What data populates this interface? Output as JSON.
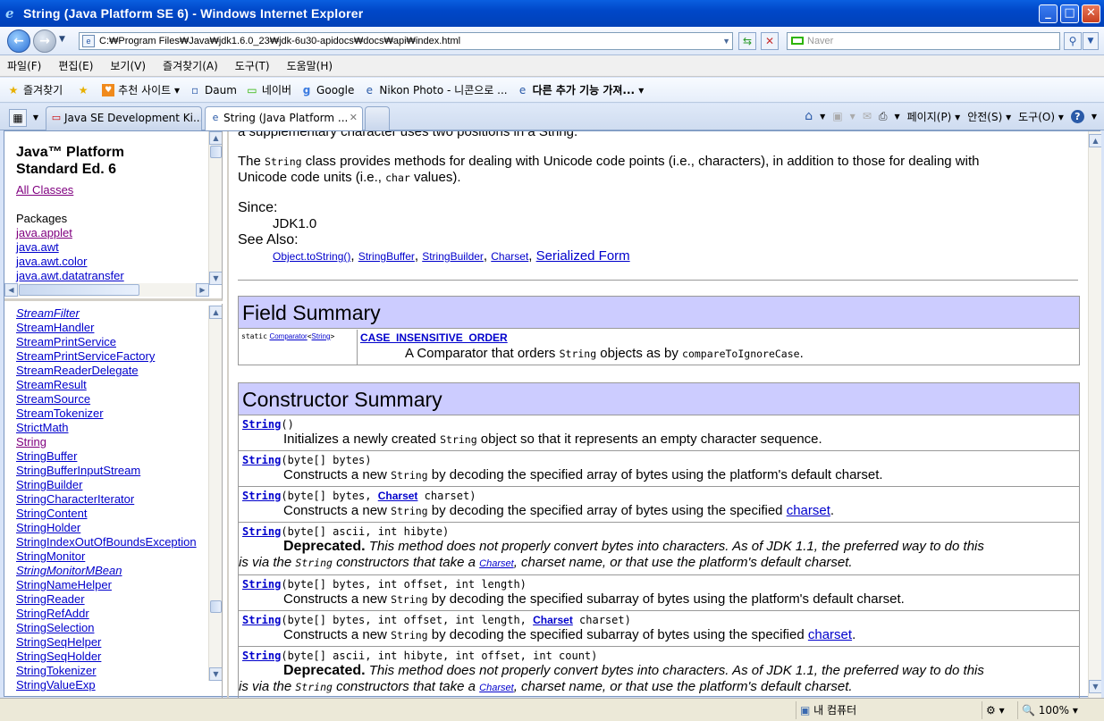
{
  "window": {
    "title": "String (Java Platform SE 6) - Windows Internet Explorer"
  },
  "address": {
    "url": "C:₩Program Files₩Java₩jdk1.6.0_23₩jdk-6u30-apidocs₩docs₩api₩index.html",
    "search_placeholder": "Naver"
  },
  "menu": [
    "파일(F)",
    "편집(E)",
    "보기(V)",
    "즐겨찾기(A)",
    "도구(T)",
    "도움말(H)"
  ],
  "favorites": {
    "label": "즐겨찾기",
    "items": [
      "추천 사이트 ▾",
      "Daum",
      "네이버",
      "Google",
      "Nikon Photo - 니콘으로 ...",
      "다른 추가 기능 가져... ▾"
    ]
  },
  "tabs": [
    {
      "label": "Java SE Development Ki..."
    },
    {
      "label": "String (Java Platform ..."
    }
  ],
  "tools": {
    "page": "페이지(P) ▾",
    "safety": "안전(S) ▾",
    "tools": "도구(O) ▾"
  },
  "left_top": {
    "title_line1": "Java™ Platform",
    "title_line2": "Standard Ed. 6",
    "all_classes": "All Classes",
    "packages_label": "Packages",
    "packages": [
      "java.applet",
      "java.awt",
      "java.awt.color",
      "java.awt.datatransfer"
    ]
  },
  "left_classes": [
    {
      "name": "StreamFilter",
      "italic": true
    },
    {
      "name": "StreamHandler"
    },
    {
      "name": "StreamPrintService"
    },
    {
      "name": "StreamPrintServiceFactory"
    },
    {
      "name": "StreamReaderDelegate"
    },
    {
      "name": "StreamResult"
    },
    {
      "name": "StreamSource"
    },
    {
      "name": "StreamTokenizer"
    },
    {
      "name": "StrictMath"
    },
    {
      "name": "String",
      "visited": true
    },
    {
      "name": "StringBuffer"
    },
    {
      "name": "StringBufferInputStream"
    },
    {
      "name": "StringBuilder"
    },
    {
      "name": "StringCharacterIterator"
    },
    {
      "name": "StringContent"
    },
    {
      "name": "StringHolder"
    },
    {
      "name": "StringIndexOutOfBoundsException"
    },
    {
      "name": "StringMonitor"
    },
    {
      "name": "StringMonitorMBean",
      "italic": true
    },
    {
      "name": "StringNameHelper"
    },
    {
      "name": "StringReader"
    },
    {
      "name": "StringRefAddr"
    },
    {
      "name": "StringSelection"
    },
    {
      "name": "StringSeqHelper"
    },
    {
      "name": "StringSeqHolder"
    },
    {
      "name": "StringTokenizer"
    },
    {
      "name": "StringValueExp"
    }
  ],
  "main": {
    "cut_line": "a supplementary character uses two positions in a String.",
    "intro_pre": "The ",
    "intro_code1": "String",
    "intro_mid": " class provides methods for dealing with Unicode code points (i.e., characters), in addition to those for dealing with",
    "intro_line2_pre": "Unicode code units (i.e., ",
    "intro_code2": "char",
    "intro_line2_post": " values).",
    "since_label": "Since:",
    "since_value": "JDK1.0",
    "see_also_label": "See Also:",
    "see_also": [
      "Object.toString()",
      "StringBuffer",
      "StringBuilder",
      "Charset"
    ],
    "serialized_form": "Serialized Form",
    "field_summary": {
      "title": "Field Summary",
      "modifier": "static",
      "type_link": "Comparator",
      "type_param": "String",
      "name": "CASE_INSENSITIVE_ORDER",
      "desc_pre": "A Comparator that orders ",
      "desc_code": "String",
      "desc_mid": " objects as by ",
      "desc_code2": "compareToIgnoreCase",
      "desc_post": "."
    },
    "constructor_summary": {
      "title": "Constructor Summary",
      "rows": [
        {
          "name": "String",
          "params": "()",
          "desc_pre": "Initializes a newly created ",
          "desc_code": "String",
          "desc_post": " object so that it represents an empty character sequence."
        },
        {
          "name": "String",
          "params": "(byte[] bytes)",
          "desc_pre": "Constructs a new ",
          "desc_code": "String",
          "desc_post": " by decoding the specified array of bytes using the platform's default charset."
        },
        {
          "name": "String",
          "params_pre": "(byte[] bytes, ",
          "param_link": "Charset",
          "params_post": " charset)",
          "desc_pre": "Constructs a new ",
          "desc_code": "String",
          "desc_post": " by decoding the specified array of bytes using the specified ",
          "desc_link": "charset",
          "desc_end": "."
        },
        {
          "name": "String",
          "params": "(byte[] ascii, int hibyte)",
          "deprecated": "Deprecated.",
          "dep_text1": " This method does not properly convert bytes into characters. As of JDK 1.1, the preferred way to do this",
          "dep_text2_pre": "is via the ",
          "dep_code": "String",
          "dep_text2_mid": " constructors that take a ",
          "dep_link": "Charset",
          "dep_text2_post": ", charset name, or that use the platform's default charset."
        },
        {
          "name": "String",
          "params": "(byte[] bytes, int offset, int length)",
          "desc_pre": "Constructs a new ",
          "desc_code": "String",
          "desc_post": " by decoding the specified subarray of bytes using the platform's default charset."
        },
        {
          "name": "String",
          "params_pre": "(byte[] bytes, int offset, int length, ",
          "param_link": "Charset",
          "params_post": " charset)",
          "desc_pre": "Constructs a new ",
          "desc_code": "String",
          "desc_post": " by decoding the specified subarray of bytes using the specified ",
          "desc_link": "charset",
          "desc_end": "."
        },
        {
          "name": "String",
          "params": "(byte[] ascii, int hibyte, int offset, int count)",
          "deprecated": "Deprecated.",
          "dep_text1": " This method does not properly convert bytes into characters. As of JDK 1.1, the preferred way to do this",
          "dep_text2_pre": "is via the ",
          "dep_code": "String",
          "dep_text2_mid": " constructors that take a ",
          "dep_link": "Charset",
          "dep_text2_post": ", charset name, or that use the platform's default charset."
        }
      ]
    }
  },
  "status": {
    "zone": "내 컴퓨터",
    "zoom": "100%"
  }
}
